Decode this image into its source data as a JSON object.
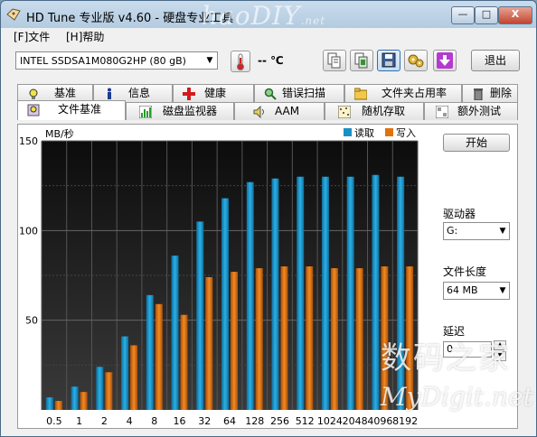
{
  "window": {
    "title": "HD Tune 专业版 v4.60 - 硬盘专业工具",
    "watermark": "haoDIY",
    "watermark_suffix": ".net",
    "controls": {
      "minimize": "—",
      "maximize": "□",
      "close": "X"
    }
  },
  "menu": {
    "file": "[F]文件",
    "help": "[H]帮助"
  },
  "toolbar": {
    "drive": "INTEL SSDSA1M080G2HP (80 gB)",
    "temperature": "-- ℃",
    "exit": "退出",
    "icons": [
      "copy-info-icon",
      "copy-screenshot-icon",
      "save-icon",
      "options-icon",
      "download-icon"
    ]
  },
  "tabs_top": [
    {
      "label": "基准",
      "icon": "benchmark-icon"
    },
    {
      "label": "信息",
      "icon": "info-icon"
    },
    {
      "label": "健康",
      "icon": "health-icon"
    },
    {
      "label": "错误扫描",
      "icon": "error-scan-icon"
    },
    {
      "label": "文件夹占用率",
      "icon": "folder-usage-icon"
    },
    {
      "label": "删除",
      "icon": "erase-icon"
    }
  ],
  "tabs_bottom": [
    {
      "label": "文件基准",
      "icon": "file-benchmark-icon",
      "selected": true
    },
    {
      "label": "磁盘监视器",
      "icon": "disk-monitor-icon"
    },
    {
      "label": "AAM",
      "icon": "speaker-icon"
    },
    {
      "label": "随机存取",
      "icon": "random-access-icon"
    },
    {
      "label": "额外测试",
      "icon": "extra-tests-icon"
    }
  ],
  "side": {
    "start": "开始",
    "drive_label": "驱动器",
    "drive_value": "G:",
    "file_length_label": "文件长度",
    "file_length_value": "64 MB",
    "delay_label": "延迟",
    "delay_value": "0"
  },
  "watermark_bottom": {
    "line1": "数码之家",
    "line2": "MyDigit.net"
  },
  "colors": {
    "read": "#1a8fc4",
    "write": "#e0720f",
    "plot_bg_top": "#0c0c0c",
    "plot_bg_bottom": "#3a3a3a"
  },
  "chart_data": {
    "type": "bar",
    "ylabel": "MB/秒",
    "ylim": [
      0,
      150
    ],
    "yticks": [
      50,
      100,
      150
    ],
    "grid": true,
    "legend_position": "top-right",
    "categories": [
      "0.5",
      "1",
      "2",
      "4",
      "8",
      "16",
      "32",
      "64",
      "128",
      "256",
      "512",
      "1024",
      "2048",
      "4096",
      "8192"
    ],
    "series": [
      {
        "name": "读取",
        "values": [
          7,
          13,
          24,
          41,
          64,
          86,
          105,
          118,
          127,
          129,
          130,
          130,
          130,
          131,
          130
        ]
      },
      {
        "name": "写入",
        "values": [
          5,
          10,
          21,
          36,
          59,
          53,
          74,
          77,
          79,
          80,
          80,
          79,
          79,
          80,
          80
        ]
      }
    ]
  }
}
